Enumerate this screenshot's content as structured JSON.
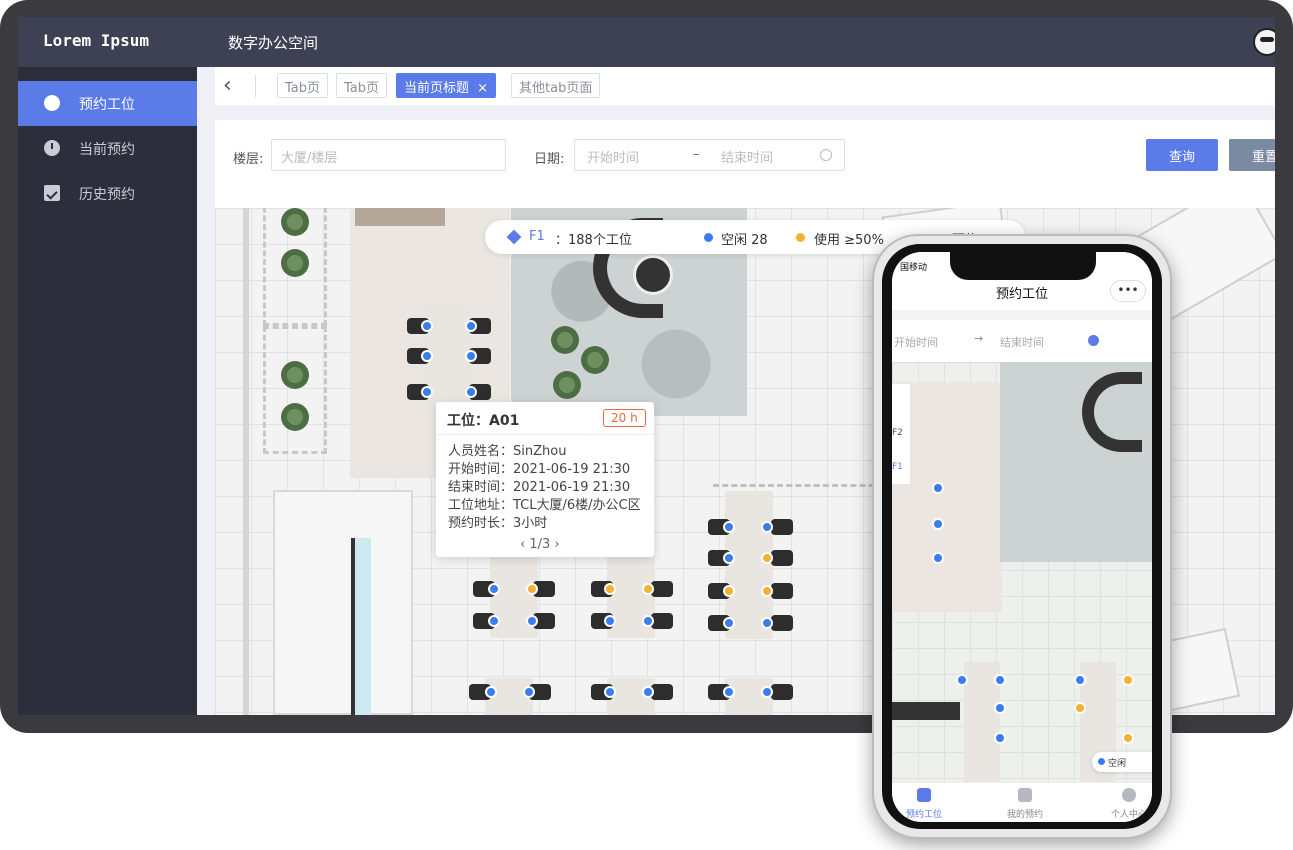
{
  "app": {
    "brand": "Lorem Ipsum",
    "title": "数字办公空间"
  },
  "sidebar": {
    "items": [
      {
        "label": "预约工位",
        "icon": "monitor-icon",
        "active": true
      },
      {
        "label": "当前预约",
        "icon": "clock-icon",
        "active": false
      },
      {
        "label": "历史预约",
        "icon": "clipboard-check-icon",
        "active": false
      }
    ]
  },
  "tabs": [
    {
      "label": "Tab页",
      "active": false
    },
    {
      "label": "Tab页",
      "active": false
    },
    {
      "label": "当前页标题",
      "active": true,
      "close": "×"
    },
    {
      "label": "其他tab页面",
      "active": false
    }
  ],
  "filter": {
    "floor_label": "楼层:",
    "floor_placeholder": "大厦/楼层",
    "date_label": "日期:",
    "start_placeholder": "开始时间",
    "range_sep": "–",
    "end_placeholder": "结束时间",
    "query_button": "查询",
    "reset_button": "重置",
    "colors": {
      "primary": "#5b7be8",
      "secondary": "#7a8aa0"
    }
  },
  "legend": {
    "floor": "F1",
    "count": "：188个工位",
    "free": "空闲 28",
    "used": "使用 ≥50%",
    "extra": "不可预约",
    "colors": {
      "free": "#3b7ded",
      "used": "#f5b130"
    }
  },
  "card": {
    "title": "工位：A01",
    "badge": "20 h",
    "rows": [
      "人员姓名：SinZhou",
      "开始时间：2021-06-19 21:30",
      "结束时间：2021-06-19 21:30",
      "工位地址：TCL大厦/6楼/办公C区",
      "预约时长：3小时"
    ],
    "pager": "‹  1/3  ›"
  },
  "phone": {
    "status": "国移动",
    "title": "预约工位",
    "more": "•••",
    "start_placeholder": "开始时间",
    "end_placeholder": "结束时间",
    "legend_free": "空闲",
    "tabs": [
      "预约工位",
      "我的预约",
      "个人中心"
    ],
    "side_labels": [
      "F2",
      "F1"
    ]
  }
}
